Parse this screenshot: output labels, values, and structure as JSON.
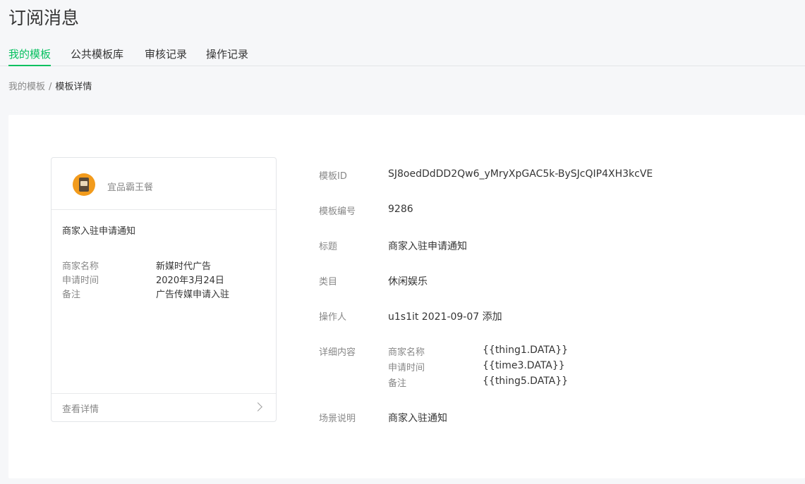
{
  "page": {
    "title": "订阅消息"
  },
  "tabs": [
    {
      "label": "我的模板",
      "active": true
    },
    {
      "label": "公共模板库"
    },
    {
      "label": "审核记录"
    },
    {
      "label": "操作记录"
    }
  ],
  "breadcrumb": {
    "parent": "我的模板",
    "separator": "/",
    "current": "模板详情"
  },
  "preview_card": {
    "brand_name": "宜品霸王餐",
    "title": "商家入驻申请通知",
    "fields": [
      {
        "key": "商家名称",
        "value": "新媒时代广告"
      },
      {
        "key": "申请时间",
        "value": "2020年3月24日"
      },
      {
        "key": "备注",
        "value": "广告传媒申请入驻"
      }
    ],
    "footer_link": "查看详情"
  },
  "info": {
    "template_id": {
      "label": "模板ID",
      "value": "SJ8oedDdDD2Qw6_yMryXpGAC5k-BySJcQIP4XH3kcVE"
    },
    "template_no": {
      "label": "模板编号",
      "value": "9286"
    },
    "title": {
      "label": "标题",
      "value": "商家入驻申请通知"
    },
    "category": {
      "label": "类目",
      "value": "休闲娱乐"
    },
    "operator": {
      "label": "操作人",
      "value": "u1s1it 2021-09-07 添加"
    },
    "detail": {
      "label": "详细内容",
      "rows": [
        {
          "key": "商家名称",
          "value": "{{thing1.DATA}}"
        },
        {
          "key": "申请时间",
          "value": "{{time3.DATA}}"
        },
        {
          "key": "备注",
          "value": "{{thing5.DATA}}"
        }
      ]
    },
    "scene": {
      "label": "场景说明",
      "value": "商家入驻通知"
    }
  },
  "colors": {
    "accent": "#07c160",
    "text": "#353535",
    "muted": "#888888",
    "avatar": "#f29b1c"
  }
}
